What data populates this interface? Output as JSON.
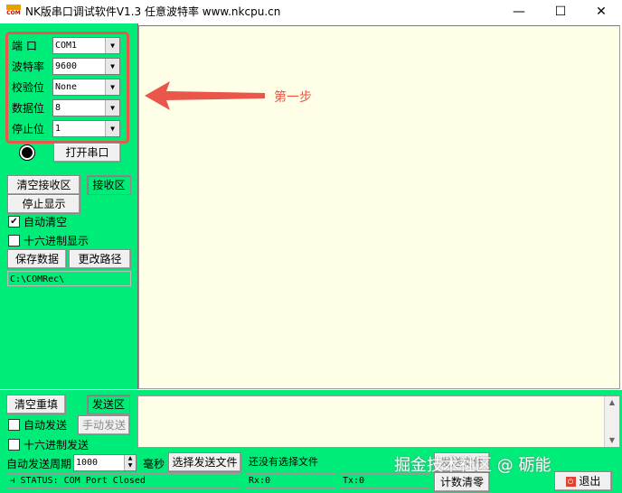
{
  "window": {
    "icon_text": "COM",
    "title": "NK版串口调试软件V1.3   任意波特率    www.nkcpu.cn",
    "minimize": "—",
    "maximize": "☐",
    "close": "✕"
  },
  "port_settings": {
    "port_label": "端  口",
    "port_value": "COM1",
    "baud_label": "波特率",
    "baud_value": "9600",
    "parity_label": "校验位",
    "parity_value": "None",
    "databits_label": "数据位",
    "databits_value": "8",
    "stopbits_label": "停止位",
    "stopbits_value": "1",
    "open_port_button": "打开串口"
  },
  "receive": {
    "clear_button": "清空接收区",
    "area_button": "接收区",
    "stop_display_button": "停止显示",
    "auto_clear_label": "自动清空",
    "auto_clear_checked": true,
    "hex_display_label": "十六进制显示",
    "hex_display_checked": false,
    "save_data_button": "保存数据",
    "change_path_button": "更改路径",
    "save_path": "C:\\COMRec\\"
  },
  "annotation": {
    "text": "第一步",
    "color": "#e8574a"
  },
  "send": {
    "clear_button": "清空重填",
    "area_button": "发送区",
    "auto_send_label": "自动发送",
    "auto_send_checked": false,
    "manual_send_button": "手动发送",
    "hex_send_label": "十六进制发送",
    "hex_send_checked": false,
    "period_label": "自动发送周期",
    "period_value": "1000",
    "period_unit": "毫秒",
    "select_file_button": "选择发送文件",
    "file_status": "还没有选择文件",
    "send_file_button": "发送文件",
    "count_reset_button": "计数清零",
    "exit_button": "退出"
  },
  "status": {
    "text": "STATUS: COM Port Closed",
    "rx": "Rx:0",
    "tx": "Tx:0"
  },
  "watermark": "掘金技术社区 @ 砺能",
  "colors": {
    "panel_green": "#00ec78",
    "text_area": "#ffffe8",
    "highlight_red": "#e8574a"
  }
}
